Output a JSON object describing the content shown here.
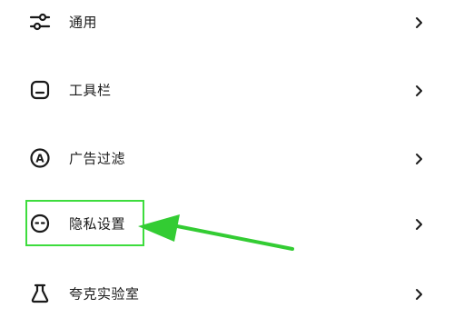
{
  "menu": {
    "items": [
      {
        "label": "通用",
        "icon": "sliders-icon"
      },
      {
        "label": "工具栏",
        "icon": "toolbar-icon"
      },
      {
        "label": "广告过滤",
        "icon": "ad-filter-icon"
      },
      {
        "label": "隐私设置",
        "icon": "privacy-mask-icon"
      },
      {
        "label": "夸克实验室",
        "icon": "flask-icon"
      }
    ],
    "chevron_icon": "chevron-right-icon"
  },
  "annotation": {
    "highlight_color": "#3ddc3d",
    "arrow_color": "#33cc33",
    "highlighted_item": "隐私设置"
  }
}
